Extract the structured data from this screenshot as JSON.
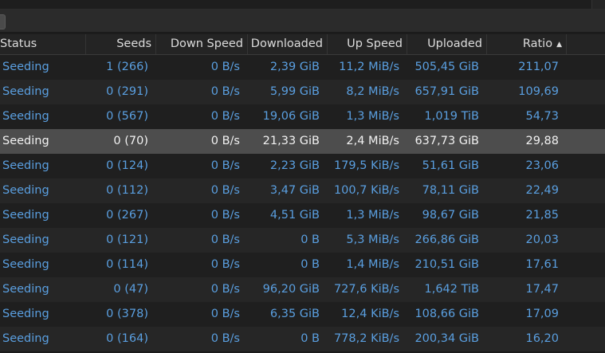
{
  "columns": {
    "status": "Status",
    "seeds": "Seeds",
    "down_speed": "Down Speed",
    "downloaded": "Downloaded",
    "up_speed": "Up Speed",
    "uploaded": "Uploaded",
    "ratio": "Ratio",
    "sort_indicator": "▲"
  },
  "selected_row_index": 3,
  "torrents": [
    {
      "status": "Seeding",
      "seeds": "1 (266)",
      "down_speed": "0 B/s",
      "downloaded": "2,39 GiB",
      "up_speed": "11,2 MiB/s",
      "uploaded": "505,45 GiB",
      "ratio": "211,07"
    },
    {
      "status": "Seeding",
      "seeds": "0 (291)",
      "down_speed": "0 B/s",
      "downloaded": "5,99 GiB",
      "up_speed": "8,2 MiB/s",
      "uploaded": "657,91 GiB",
      "ratio": "109,69"
    },
    {
      "status": "Seeding",
      "seeds": "0 (567)",
      "down_speed": "0 B/s",
      "downloaded": "19,06 GiB",
      "up_speed": "1,3 MiB/s",
      "uploaded": "1,019 TiB",
      "ratio": "54,73"
    },
    {
      "status": "Seeding",
      "seeds": "0 (70)",
      "down_speed": "0 B/s",
      "downloaded": "21,33 GiB",
      "up_speed": "2,4 MiB/s",
      "uploaded": "637,73 GiB",
      "ratio": "29,88"
    },
    {
      "status": "Seeding",
      "seeds": "0 (124)",
      "down_speed": "0 B/s",
      "downloaded": "2,23 GiB",
      "up_speed": "179,5 KiB/s",
      "uploaded": "51,61 GiB",
      "ratio": "23,06"
    },
    {
      "status": "Seeding",
      "seeds": "0 (112)",
      "down_speed": "0 B/s",
      "downloaded": "3,47 GiB",
      "up_speed": "100,7 KiB/s",
      "uploaded": "78,11 GiB",
      "ratio": "22,49"
    },
    {
      "status": "Seeding",
      "seeds": "0 (267)",
      "down_speed": "0 B/s",
      "downloaded": "4,51 GiB",
      "up_speed": "1,3 MiB/s",
      "uploaded": "98,67 GiB",
      "ratio": "21,85"
    },
    {
      "status": "Seeding",
      "seeds": "0 (121)",
      "down_speed": "0 B/s",
      "downloaded": "0 B",
      "up_speed": "5,3 MiB/s",
      "uploaded": "266,86 GiB",
      "ratio": "20,03"
    },
    {
      "status": "Seeding",
      "seeds": "0 (114)",
      "down_speed": "0 B/s",
      "downloaded": "0 B",
      "up_speed": "1,4 MiB/s",
      "uploaded": "210,51 GiB",
      "ratio": "17,61"
    },
    {
      "status": "Seeding",
      "seeds": "0 (47)",
      "down_speed": "0 B/s",
      "downloaded": "96,20 GiB",
      "up_speed": "727,6 KiB/s",
      "uploaded": "1,642 TiB",
      "ratio": "17,47"
    },
    {
      "status": "Seeding",
      "seeds": "0 (378)",
      "down_speed": "0 B/s",
      "downloaded": "6,35 GiB",
      "up_speed": "12,4 KiB/s",
      "uploaded": "108,66 GiB",
      "ratio": "17,09"
    },
    {
      "status": "Seeding",
      "seeds": "0 (164)",
      "down_speed": "0 B/s",
      "downloaded": "0 B",
      "up_speed": "778,2 KiB/s",
      "uploaded": "200,34 GiB",
      "ratio": "16,20"
    }
  ],
  "colors": {
    "status_text": "#5a9fe0",
    "selected_text": "#f2f2f2",
    "selected_row": "#4d4d4d",
    "header_text": "#dcdcdc"
  }
}
